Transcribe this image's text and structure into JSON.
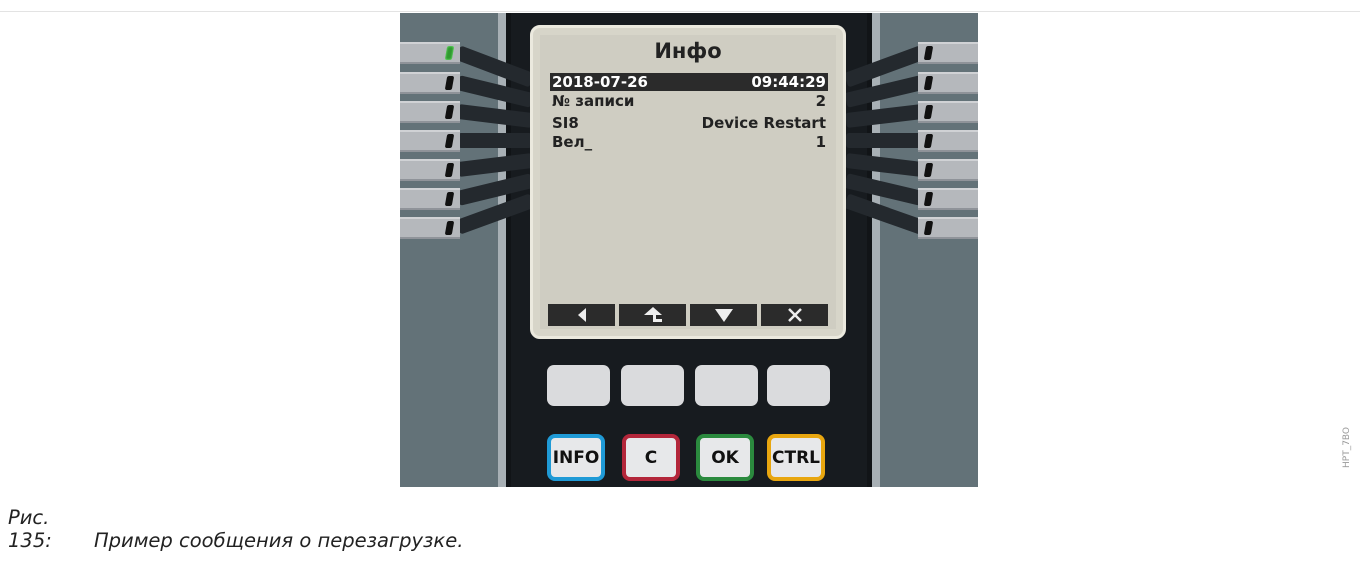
{
  "screen": {
    "title": "Инфо",
    "rows": [
      {
        "left": "2018-07-26",
        "right": "09:44:29",
        "highlighted": true
      },
      {
        "left": "№ записи",
        "right": "2"
      },
      {
        "left": "SI8",
        "right": "Device Restart"
      },
      {
        "left": "Вел_",
        "right": "1"
      }
    ],
    "softkeys": [
      "arrow-left-icon",
      "arrow-up-return-icon",
      "arrow-down-icon",
      "close-icon"
    ]
  },
  "keys": {
    "info": {
      "label": "INFO",
      "color": "#1f9ad6"
    },
    "clear": {
      "label": "C",
      "color": "#b3263a"
    },
    "ok": {
      "label": "OK",
      "color": "#2b8a3e"
    },
    "ctrl": {
      "label": "CTRL",
      "color": "#e8a60f"
    }
  },
  "leds": {
    "active_left_index": 0,
    "active_color": "#2f9a2f"
  },
  "caption": {
    "number": "Рис. 135:",
    "text": "Пример сообщения о перезагрузке."
  },
  "figure_id": "HPT_7BO"
}
